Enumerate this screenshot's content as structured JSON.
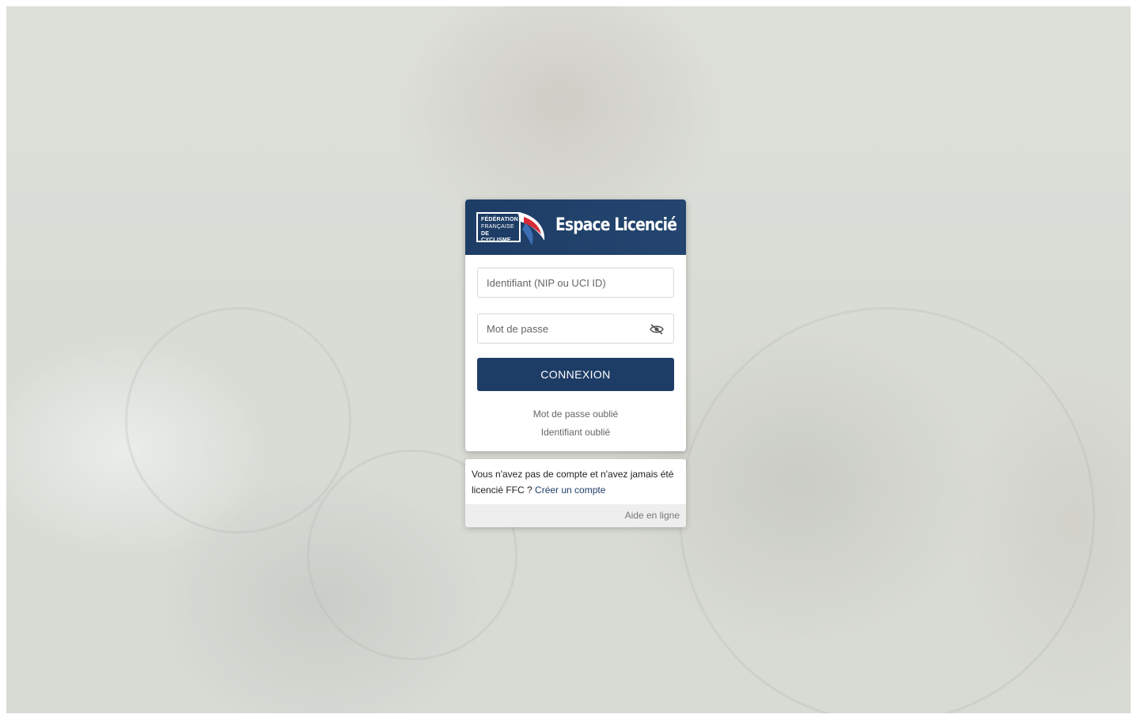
{
  "header": {
    "logo_lines": [
      "FÉDÉRATION",
      "FRANÇAISE",
      "DE CYCLISME"
    ],
    "title": "Espace Licencié"
  },
  "login": {
    "identifier_placeholder": "Identifiant (NIP ou UCI ID)",
    "password_placeholder": "Mot de passe",
    "submit_label": "CONNEXION",
    "forgot_password": "Mot de passe oublié",
    "forgot_identifier": "Identifiant oublié"
  },
  "signup": {
    "text": "Vous n'avez pas de compte et n'avez jamais été licencié FFC ?",
    "link": "Créer un compte",
    "help": "Aide en ligne"
  },
  "colors": {
    "brand": "#1e3d66",
    "accent_red": "#d62b36"
  }
}
